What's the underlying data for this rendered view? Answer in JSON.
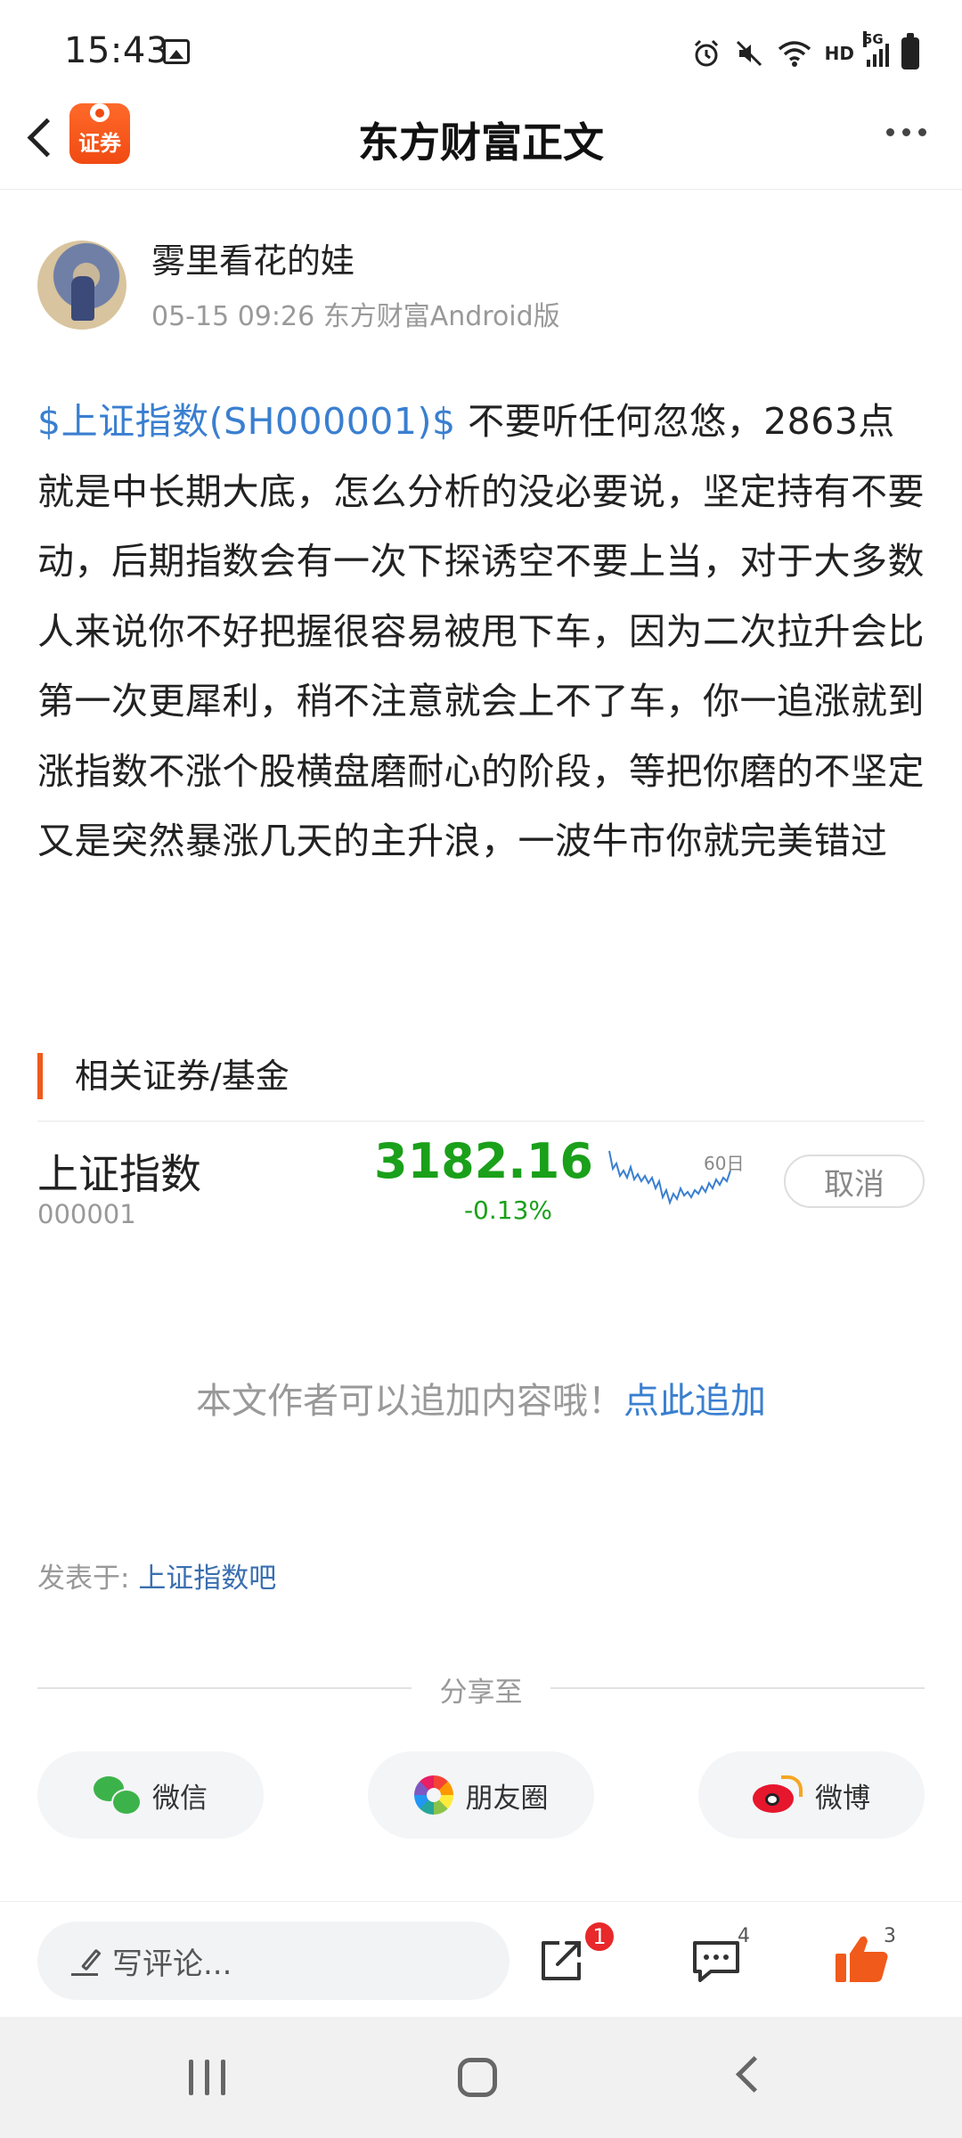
{
  "status_bar": {
    "time": "15:43",
    "hd_label": "HD",
    "network_label": "5G",
    "icons": [
      "image-icon",
      "alarm-icon",
      "mute-icon",
      "wifi-icon",
      "signal-icon",
      "battery-icon"
    ]
  },
  "header": {
    "app_logo_text": "证券",
    "title": "东方财富正文"
  },
  "author": {
    "name": "雾里看花的娃",
    "meta": "05-15 09:26 东方财富Android版"
  },
  "article": {
    "stock_link": "$上证指数(SH000001)$",
    "body": " 不要听任何忽悠，2863点就是中长期大底，怎么分析的没必要说，坚定持有不要动，后期指数会有一次下探诱空不要上当，对于大多数人来说你不好把握很容易被甩下车，因为二次拉升会比第一次更犀利，稍不注意就会上不了车，你一追涨就到涨指数不涨个股横盘磨耐心的阶段，等把你磨的不坚定又是突然暴涨几天的主升浪，一波牛市你就完美错过"
  },
  "related": {
    "title": "相关证券/基金",
    "stock": {
      "name": "上证指数",
      "code": "000001",
      "price": "3182.16",
      "change": "-0.13%",
      "sparkline_label": "60日",
      "cancel_label": "取消",
      "color": "#1aa01a"
    }
  },
  "append": {
    "text": "本文作者可以追加内容哦！",
    "link": "点此追加"
  },
  "posted": {
    "label": "发表于: ",
    "link": "上证指数吧"
  },
  "share": {
    "label": "分享至",
    "wechat": "微信",
    "moments": "朋友圈",
    "weibo": "微博"
  },
  "bottom_bar": {
    "comment_placeholder": "写评论...",
    "share_badge": "1",
    "comment_count": "4",
    "like_count": "3",
    "like_color": "#f05a1a"
  },
  "colors": {
    "accent": "#f05a1a",
    "link": "#3a7fd0",
    "down": "#1aa01a"
  }
}
